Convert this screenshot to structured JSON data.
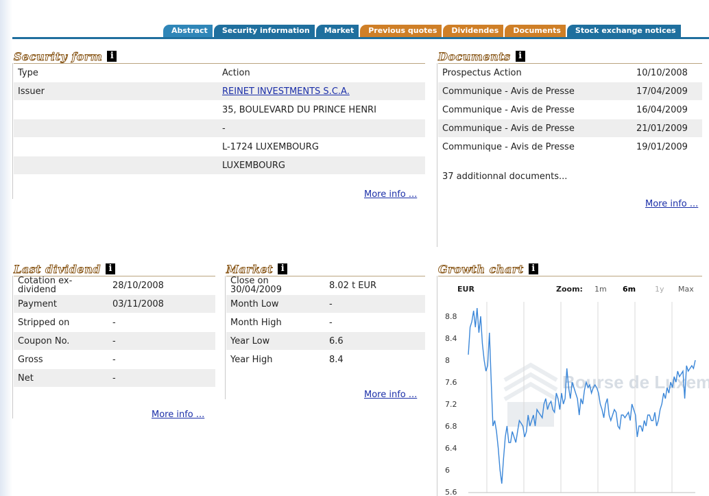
{
  "tabs": [
    {
      "label": "Abstract",
      "color": "blue"
    },
    {
      "label": "Security information",
      "color": "blue"
    },
    {
      "label": "Market",
      "color": "blue"
    },
    {
      "label": "Previous quotes",
      "color": "orange"
    },
    {
      "label": "Dividendes",
      "color": "orange"
    },
    {
      "label": "Documents",
      "color": "orange"
    },
    {
      "label": "Stock exchange notices",
      "color": "blue"
    }
  ],
  "security_form": {
    "title": "Security form",
    "info_icon": "i",
    "rows": [
      {
        "label": "Type",
        "value": "Action"
      },
      {
        "label": "Issuer",
        "value": "REINET INVESTMENTS S.C.A."
      },
      {
        "label": "",
        "value": "35, BOULEVARD DU PRINCE HENRI"
      },
      {
        "label": "",
        "value": "-"
      },
      {
        "label": "",
        "value": "L-1724 LUXEMBOURG"
      },
      {
        "label": "",
        "value": "LUXEMBOURG"
      }
    ],
    "more": "More info ..."
  },
  "documents": {
    "title": "Documents",
    "info_icon": "i",
    "rows": [
      {
        "name": "Prospectus Action",
        "date": "10/10/2008"
      },
      {
        "name": "Communique - Avis de Presse",
        "date": "17/04/2009"
      },
      {
        "name": "Communique - Avis de Presse",
        "date": "16/04/2009"
      },
      {
        "name": "Communique - Avis de Presse",
        "date": "21/01/2009"
      },
      {
        "name": "Communique - Avis de Presse",
        "date": "19/01/2009"
      }
    ],
    "additional": "37 additionnal documents...",
    "more": "More info ..."
  },
  "last_dividend": {
    "title": "Last dividend",
    "info_icon": "i",
    "rows": [
      {
        "label": "Cotation ex-dividend",
        "value": "28/10/2008"
      },
      {
        "label": "Payment",
        "value": "03/11/2008"
      },
      {
        "label": "Stripped on",
        "value": "-"
      },
      {
        "label": "Coupon No.",
        "value": "-"
      },
      {
        "label": "Gross",
        "value": "-"
      },
      {
        "label": "Net",
        "value": "-"
      }
    ],
    "more": "More info ..."
  },
  "market": {
    "title": "Market",
    "info_icon": "i",
    "rows": [
      {
        "label": "Close on 30/04/2009",
        "value": "8.02 t EUR"
      },
      {
        "label": "Month Low",
        "value": "-"
      },
      {
        "label": "Month High",
        "value": "-"
      },
      {
        "label": "Year Low",
        "value": "6.6"
      },
      {
        "label": "Year High",
        "value": "8.4"
      }
    ],
    "more": "More info ..."
  },
  "growth_chart": {
    "title": "Growth chart",
    "info_icon": "i",
    "currency": "EUR",
    "zoom_label": "Zoom:",
    "zoom_options": [
      "1m",
      "6m",
      "1y",
      "Max"
    ],
    "zoom_selected": "6m",
    "watermark": "Bourse de Luxembourg"
  },
  "chart_data": {
    "type": "line",
    "y_ticks": [
      "8.8",
      "8.4",
      "8",
      "7.6",
      "7.2",
      "6.8",
      "6.4",
      "6",
      "5.6"
    ],
    "ylim": [
      5.6,
      9.0
    ],
    "line_color": "#3a86d8",
    "values": [
      8.1,
      8.6,
      8.7,
      8.9,
      8.6,
      8.95,
      8.5,
      8.8,
      8.3,
      8.0,
      7.8,
      7.9,
      8.5,
      7.6,
      6.8,
      6.9,
      6.7,
      6.4,
      6.0,
      5.75,
      6.2,
      6.6,
      6.8,
      6.5,
      6.5,
      6.7,
      6.6,
      6.5,
      6.7,
      6.9,
      6.85,
      6.8,
      6.6,
      6.7,
      7.0,
      6.8,
      6.9,
      7.0,
      6.8,
      7.1,
      7.05,
      7.0,
      6.95,
      7.2,
      7.3,
      7.1,
      7.2,
      7.25,
      7.1,
      7.05,
      7.4,
      7.3,
      7.1,
      7.4,
      7.2,
      7.3,
      7.85,
      7.5,
      7.3,
      7.6,
      7.5,
      7.4,
      7.3,
      7.0,
      7.3,
      7.2,
      7.45,
      7.6,
      7.5,
      7.55,
      7.4,
      7.5,
      7.55,
      7.5,
      7.4,
      7.2,
      7.1,
      6.95,
      7.2,
      7.3,
      7.0,
      6.9,
      7.0,
      7.1,
      7.05,
      6.8,
      6.75,
      7.0,
      7.0,
      6.95,
      7.0,
      7.05,
      6.9,
      7.2,
      7.1,
      7.0,
      6.6,
      6.8,
      6.8,
      6.7,
      6.9,
      6.8,
      7.0,
      7.0,
      6.9,
      6.9,
      7.05,
      6.8,
      6.9,
      7.1,
      7.2,
      7.4,
      7.3,
      7.5,
      7.4,
      7.6,
      7.5,
      7.7,
      7.6,
      7.8,
      7.7,
      7.75,
      7.8,
      7.3,
      7.9,
      7.8,
      7.85,
      7.9,
      7.85,
      8.0
    ]
  }
}
